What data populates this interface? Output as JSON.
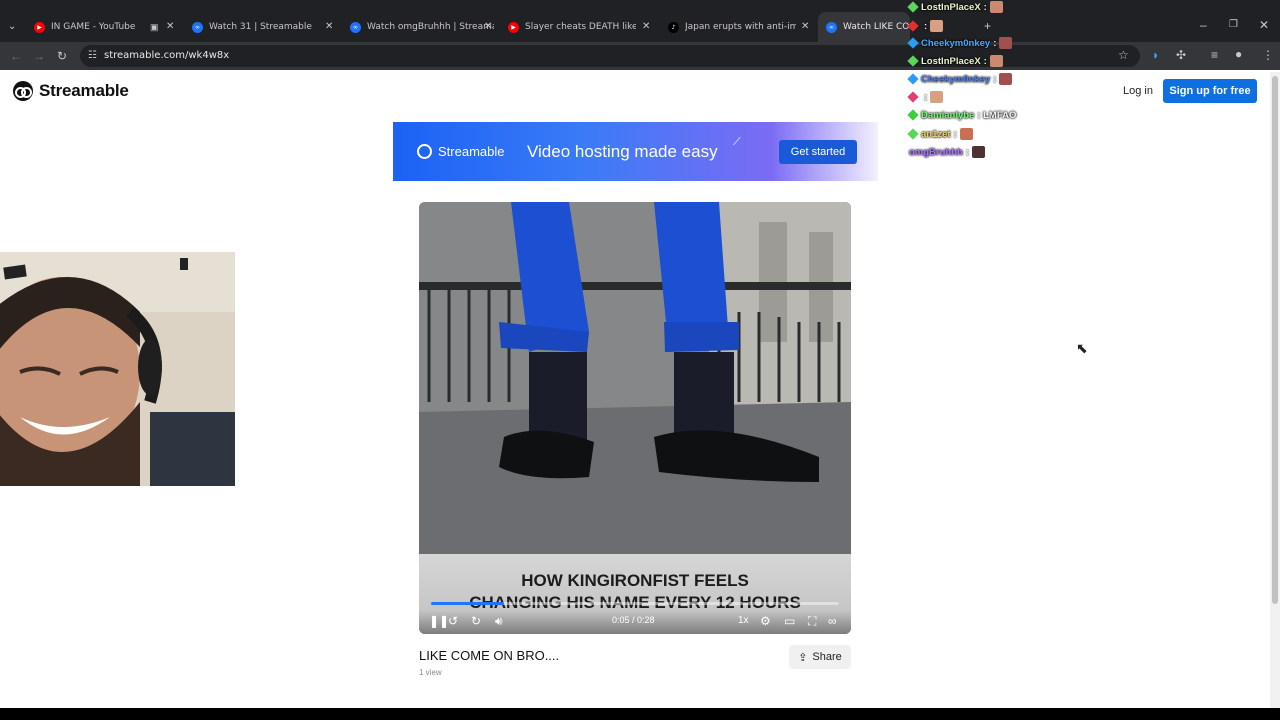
{
  "browser": {
    "tabs": [
      {
        "title": "IN GAME - YouTube",
        "favicon": "youtube-icon",
        "color": "#ff0000"
      },
      {
        "title": "Watch 31 | Streamable",
        "favicon": "streamable-icon",
        "color": "#1e73ff"
      },
      {
        "title": "Watch omgBruhhh | Streamable",
        "favicon": "streamable-icon",
        "color": "#1e73ff"
      },
      {
        "title": "Slayer cheats DEATH like a boss",
        "favicon": "youtube-icon",
        "color": "#ff0000"
      },
      {
        "title": "Japan erupts with anti-immigra",
        "favicon": "tiktok-icon",
        "color": "#ffffff"
      },
      {
        "title": "Watch LIKE COME C",
        "favicon": "streamable-icon",
        "color": "#1e73ff",
        "active": true
      }
    ],
    "url": "streamable.com/wk4w8x"
  },
  "header": {
    "logo_text": "Streamable",
    "login_label": "Log in",
    "signup_label": "Sign up for free"
  },
  "banner": {
    "brand": "Streamable",
    "tagline": "Video hosting made easy",
    "cta_label": "Get started"
  },
  "player": {
    "caption_line1": "HOW KINGIRONFIST FEELS",
    "caption_line2": "CHANGING HIS NAME EVERY 12 HOURS",
    "time": "0:05 / 0:28",
    "progress": 0.18,
    "speed_label": "1x"
  },
  "video": {
    "title": "LIKE COME ON BRO....",
    "views": "1 view",
    "share_label": "Share"
  },
  "chat": [
    {
      "user": "LostInPlaceX",
      "msg": ":",
      "color": "#e8f7c8",
      "badge": "#5ad65a",
      "emote": "#c98a70"
    },
    {
      "user": "",
      "msg": ":",
      "color": "#ff6b6b",
      "badge": "#e23030",
      "emote": "#d8a080"
    },
    {
      "user": "Cheekym0nkey",
      "msg": ":",
      "color": "#4aa8ff",
      "badge": "#2a9df4",
      "emote": "#a05050"
    },
    {
      "user": "LostInPlaceX",
      "msg": ":",
      "color": "#e8f7c8",
      "badge": "#5ad65a",
      "emote": "#c98a70"
    },
    {
      "user": "Cheekym0nkey",
      "msg": ":",
      "color": "#4a7cff",
      "badge": "#2a9df4",
      "emote": "#a05050"
    },
    {
      "user": "",
      "msg": ":",
      "color": "#ff5a8a",
      "badge": "#e04070",
      "emote": "#d8a080"
    },
    {
      "user": "Damianlybe",
      "msg": ": LMFAO",
      "color": "#6bff6b",
      "badge": "#3ccf3c",
      "emote": ""
    },
    {
      "user": "an1zet",
      "msg": ":",
      "color": "#f0d070",
      "badge": "#5ad65a",
      "emote": "#c97050"
    },
    {
      "user": "omgBruhhh",
      "msg": ":",
      "color": "#b070ff",
      "badge": "",
      "emote": "#503030"
    }
  ]
}
